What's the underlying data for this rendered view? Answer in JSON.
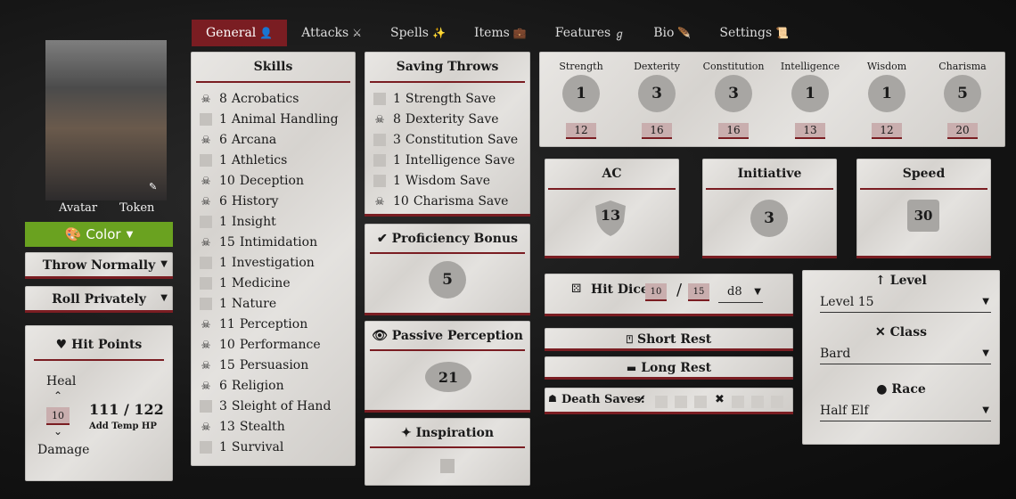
{
  "nav": {
    "tabs": [
      {
        "label": "General",
        "icon": "👤"
      },
      {
        "label": "Attacks",
        "icon": "⚔"
      },
      {
        "label": "Spells",
        "icon": "✨"
      },
      {
        "label": "Items",
        "icon": "💼"
      },
      {
        "label": "Features",
        "icon": "ℊ"
      },
      {
        "label": "Bio",
        "icon": "🪶"
      },
      {
        "label": "Settings",
        "icon": "📜"
      }
    ]
  },
  "left": {
    "avatar_label": "Avatar",
    "token_label": "Token",
    "color_label": "Color",
    "throw_select": "Throw Normally",
    "roll_select": "Roll Privately",
    "hp_title": "Hit Points",
    "heal_label": "Heal",
    "damage_label": "Damage",
    "hp_step": "10",
    "hp_current": "111",
    "hp_sep": "/",
    "hp_max": "122",
    "temp_hp": "Add Temp HP"
  },
  "skills": {
    "title": "Skills",
    "items": [
      {
        "value": "8",
        "name": "Acrobatics",
        "prof": true
      },
      {
        "value": "1",
        "name": "Animal Handling",
        "prof": false
      },
      {
        "value": "6",
        "name": "Arcana",
        "prof": true
      },
      {
        "value": "1",
        "name": "Athletics",
        "prof": false
      },
      {
        "value": "10",
        "name": "Deception",
        "prof": true
      },
      {
        "value": "6",
        "name": "History",
        "prof": true
      },
      {
        "value": "1",
        "name": "Insight",
        "prof": false
      },
      {
        "value": "15",
        "name": "Intimidation",
        "prof": true
      },
      {
        "value": "1",
        "name": "Investigation",
        "prof": false
      },
      {
        "value": "1",
        "name": "Medicine",
        "prof": false
      },
      {
        "value": "1",
        "name": "Nature",
        "prof": false
      },
      {
        "value": "11",
        "name": "Perception",
        "prof": true
      },
      {
        "value": "10",
        "name": "Performance",
        "prof": true
      },
      {
        "value": "15",
        "name": "Persuasion",
        "prof": true
      },
      {
        "value": "6",
        "name": "Religion",
        "prof": true
      },
      {
        "value": "3",
        "name": "Sleight of Hand",
        "prof": false
      },
      {
        "value": "13",
        "name": "Stealth",
        "prof": true
      },
      {
        "value": "1",
        "name": "Survival",
        "prof": false
      }
    ]
  },
  "saves": {
    "title": "Saving Throws",
    "items": [
      {
        "value": "1",
        "name": "Strength Save",
        "prof": false
      },
      {
        "value": "8",
        "name": "Dexterity Save",
        "prof": true
      },
      {
        "value": "3",
        "name": "Constitution Save",
        "prof": false
      },
      {
        "value": "1",
        "name": "Intelligence Save",
        "prof": false
      },
      {
        "value": "1",
        "name": "Wisdom Save",
        "prof": false
      },
      {
        "value": "10",
        "name": "Charisma Save",
        "prof": true
      }
    ]
  },
  "prof_bonus": {
    "title": "Proficiency Bonus",
    "value": "5"
  },
  "passive_perception": {
    "title": "Passive Perception",
    "value": "21"
  },
  "inspiration": {
    "title": "Inspiration"
  },
  "abilities": [
    {
      "name": "Strength",
      "mod": "1",
      "score": "12"
    },
    {
      "name": "Dexterity",
      "mod": "3",
      "score": "16"
    },
    {
      "name": "Constitution",
      "mod": "3",
      "score": "16"
    },
    {
      "name": "Intelligence",
      "mod": "1",
      "score": "13"
    },
    {
      "name": "Wisdom",
      "mod": "1",
      "score": "12"
    },
    {
      "name": "Charisma",
      "mod": "5",
      "score": "20"
    }
  ],
  "ac": {
    "title": "AC",
    "value": "13"
  },
  "initiative": {
    "title": "Initiative",
    "value": "3"
  },
  "speed": {
    "title": "Speed",
    "value": "30"
  },
  "hit_dice": {
    "label": "Hit Dice:",
    "current": "10",
    "sep": "/",
    "max": "15",
    "die": "d8"
  },
  "rest": {
    "short": "Short Rest",
    "long": "Long Rest"
  },
  "death_saves": {
    "label": "Death Saves:",
    "success_mark": "✔",
    "fail_mark": "✖"
  },
  "level": {
    "title": "Level",
    "value": "Level 15"
  },
  "class": {
    "title": "Class",
    "value": "Bard"
  },
  "race": {
    "title": "Race",
    "value": "Half Elf"
  }
}
